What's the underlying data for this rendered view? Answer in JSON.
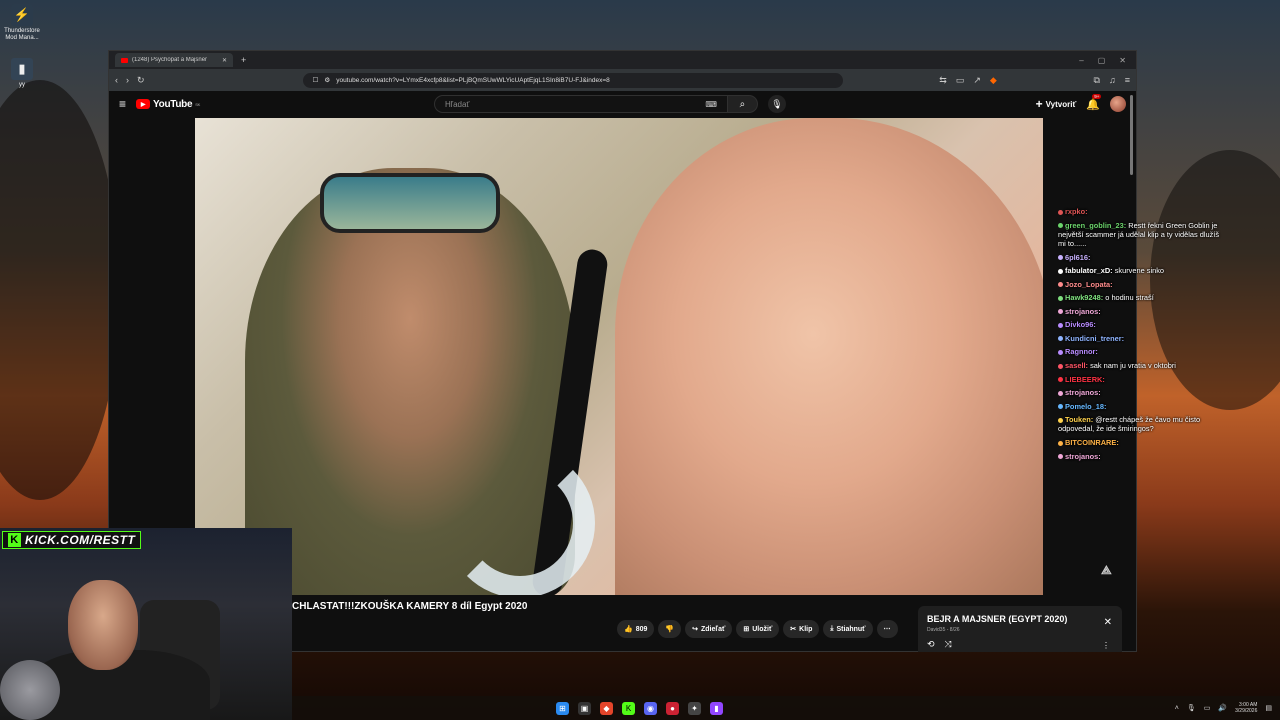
{
  "desktop": {
    "icons": [
      {
        "label": "Thunderstore Mod Mana..."
      },
      {
        "label": "yy"
      }
    ]
  },
  "browser": {
    "tab_title": "(1248) Psychopat a Majsner",
    "url": "youtube.com/watch?v=LYmxE4xcfp8&list=PLjBQmSUwWLYicUAptEjqL1SIn8iB7U-FJ&index=8"
  },
  "youtube": {
    "logo": "YouTube",
    "logo_region": "SK",
    "search_placeholder": "Hľadať",
    "create_label": "Vytvoriť",
    "notif_count": "9+"
  },
  "video": {
    "title": "CHLASTAT!!!ZKOUŠKA KAMERY 8 díl Egypt 2020",
    "like_count": "809",
    "share": "Zdieľať",
    "save": "Uložiť",
    "clip": "Klip",
    "download": "Stiahnuť"
  },
  "playlist": {
    "title": "BEJR A MAJSNER (EGYPT 2020)",
    "sub": "David35 - 8/26"
  },
  "chat": [
    {
      "user": "rxpko:",
      "text": "",
      "color": "#e05555"
    },
    {
      "user": "green_goblin_23:",
      "text": "Restt řekni Green Goblin je největší scammer já udělal klip a ty vidělas dlužíš mi to......",
      "color": "#6bd36b"
    },
    {
      "user": "6pl616:",
      "text": "",
      "color": "#c9b2ff"
    },
    {
      "user": "fabulator_xD:",
      "text": "skurvene sinko",
      "color": "#ffffff"
    },
    {
      "user": "Jozo_Lopata:",
      "text": "",
      "color": "#ff8c8c"
    },
    {
      "user": "Hawk9248:",
      "text": "o hodinu straší",
      "color": "#7fe07f"
    },
    {
      "user": "strojanos:",
      "text": "",
      "color": "#f0a8d8"
    },
    {
      "user": "Divko96:",
      "text": "",
      "color": "#b98cff"
    },
    {
      "user": "Kundicni_trener:",
      "text": "",
      "color": "#8fb4ff"
    },
    {
      "user": "Ragnnor:",
      "text": "",
      "color": "#b98cff"
    },
    {
      "user": "sasell:",
      "text": "sak nam ju vratia v oktobri",
      "color": "#ff5566"
    },
    {
      "user": "LIEBEERK:",
      "text": "",
      "color": "#ff3344"
    },
    {
      "user": "strojanos:",
      "text": "",
      "color": "#f0a8d8"
    },
    {
      "user": "Pomelo_18:",
      "text": "",
      "color": "#66b8ff"
    },
    {
      "user": "Touken:",
      "text": "@restt chápeš že čavo mu čisto odpovedal, že ide šmiringos?",
      "color": "#ffd24d"
    },
    {
      "user": "BITCOINRARE:",
      "text": "",
      "color": "#ffb347"
    },
    {
      "user": "strojanos:",
      "text": "",
      "color": "#f0a8d8"
    }
  ],
  "webcam": {
    "kick_label": "KICK.COM/RESTT"
  },
  "taskbar": {
    "time": "3:00 AM",
    "date": "3/29/2026"
  },
  "colors": {
    "yt_red": "#ff0000",
    "kick_green": "#53fc18"
  }
}
